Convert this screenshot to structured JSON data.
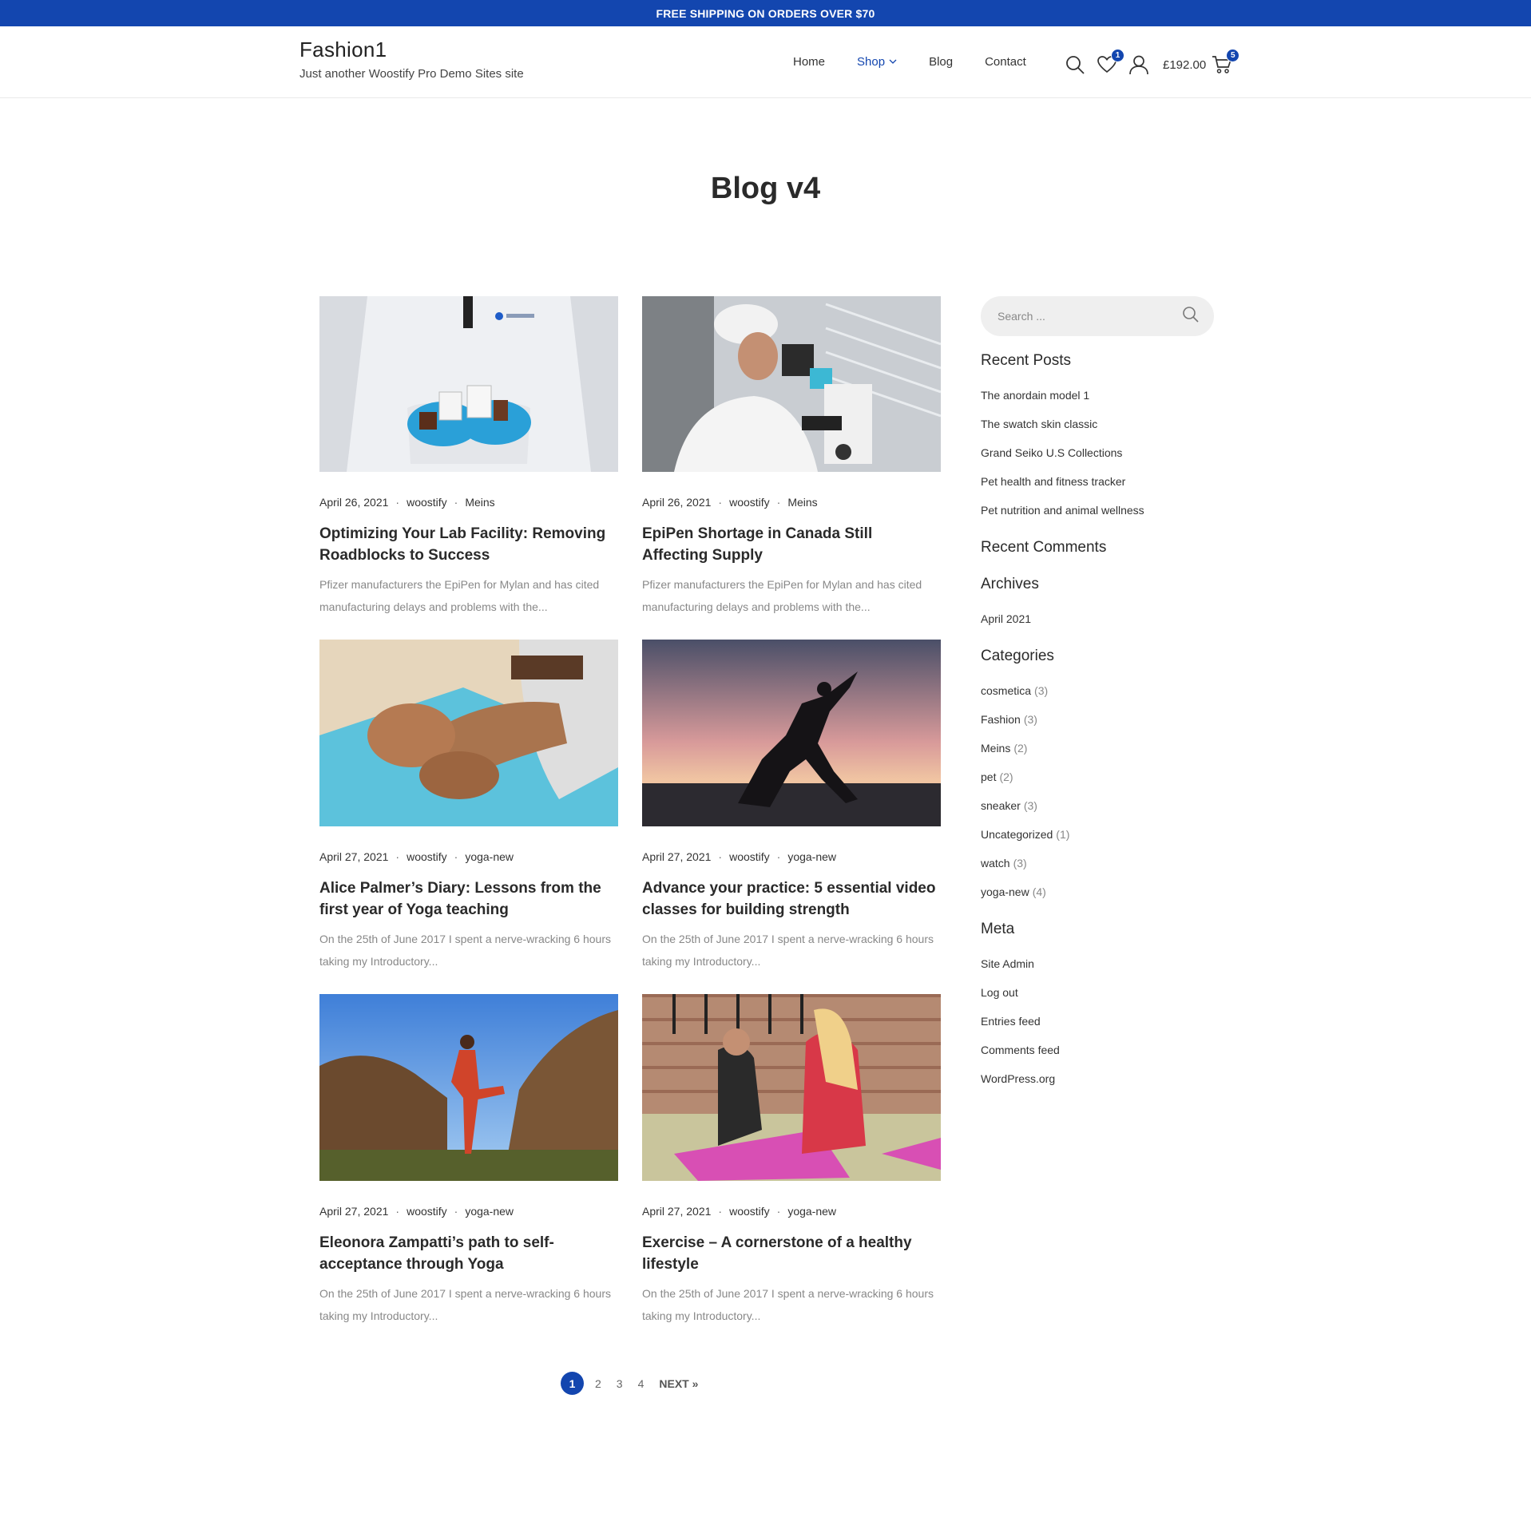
{
  "topbar": {
    "text": "FREE SHIPPING ON ORDERS OVER $70"
  },
  "header": {
    "site_title": "Fashion1",
    "tagline": "Just another Woostify Pro Demo Sites site",
    "nav": [
      {
        "label": "Home"
      },
      {
        "label": "Shop"
      },
      {
        "label": "Blog"
      },
      {
        "label": "Contact"
      }
    ],
    "wishlist_count": "1",
    "cart_total": "£192.00",
    "cart_count": "5",
    "accent_color": "#1346af"
  },
  "page": {
    "title": "Blog v4"
  },
  "posts": [
    {
      "date": "April 26, 2021",
      "author": "woostify",
      "category": "Meins",
      "title": "Optimizing Your Lab Facility: Removing Roadblocks to Success",
      "excerpt": "Pfizer manufacturers the EpiPen for Mylan and has cited manufacturing delays and problems with the..."
    },
    {
      "date": "April 26, 2021",
      "author": "woostify",
      "category": "Meins",
      "title": "EpiPen Shortage in Canada Still Affecting Supply",
      "excerpt": "Pfizer manufacturers the EpiPen for Mylan and has cited manufacturing delays and problems with the..."
    },
    {
      "date": "April 27, 2021",
      "author": "woostify",
      "category": "yoga-new",
      "title": "Alice Palmer’s Diary: Lessons from the first year of Yoga teaching",
      "excerpt": "On the 25th of June 2017 I spent a nerve-wracking 6 hours taking my Introductory..."
    },
    {
      "date": "April 27, 2021",
      "author": "woostify",
      "category": "yoga-new",
      "title": "Advance your practice: 5 essential video classes for building strength",
      "excerpt": "On the 25th of June 2017 I spent a nerve-wracking 6 hours taking my Introductory..."
    },
    {
      "date": "April 27, 2021",
      "author": "woostify",
      "category": "yoga-new",
      "title": "Eleonora Zampatti’s path to self-acceptance through Yoga",
      "excerpt": "On the 25th of June 2017 I spent a nerve-wracking 6 hours taking my Introductory..."
    },
    {
      "date": "April 27, 2021",
      "author": "woostify",
      "category": "yoga-new",
      "title": "Exercise – A cornerstone of a healthy lifestyle",
      "excerpt": "On the 25th of June 2017 I spent a nerve-wracking 6 hours taking my Introductory..."
    }
  ],
  "sidebar": {
    "search_placeholder": "Search ...",
    "recent_posts_title": "Recent Posts",
    "recent_posts": [
      "The anordain model 1",
      "The swatch skin classic",
      "Grand Seiko U.S Collections",
      "Pet health and fitness tracker",
      "Pet nutrition and animal wellness"
    ],
    "recent_comments_title": "Recent Comments",
    "archives_title": "Archives",
    "archives": [
      "April 2021"
    ],
    "categories_title": "Categories",
    "categories": [
      {
        "name": "cosmetica",
        "count": "(3)"
      },
      {
        "name": "Fashion",
        "count": "(3)"
      },
      {
        "name": "Meins",
        "count": "(2)"
      },
      {
        "name": "pet",
        "count": "(2)"
      },
      {
        "name": "sneaker",
        "count": "(3)"
      },
      {
        "name": "Uncategorized",
        "count": "(1)"
      },
      {
        "name": "watch",
        "count": "(3)"
      },
      {
        "name": "yoga-new",
        "count": "(4)"
      }
    ],
    "meta_title": "Meta",
    "meta": [
      "Site Admin",
      "Log out",
      "Entries feed",
      "Comments feed",
      "WordPress.org"
    ]
  },
  "pagination": {
    "current": "1",
    "pages": [
      "2",
      "3",
      "4"
    ],
    "next": "NEXT »"
  }
}
